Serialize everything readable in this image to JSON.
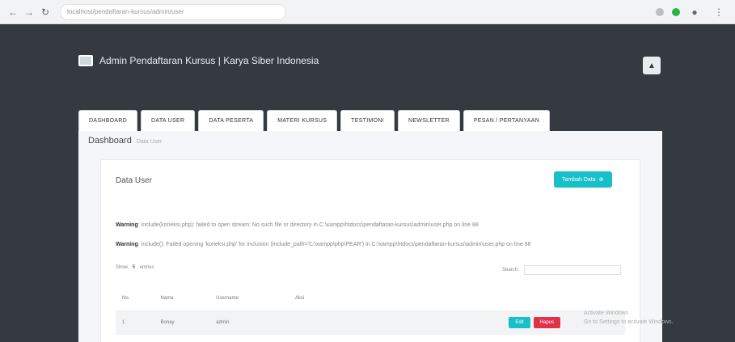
{
  "browser": {
    "url": "localhost/pendaftaran-kursus/admin/user"
  },
  "header": {
    "title": "Admin Pendaftaran Kursus | Karya Siber Indonesia"
  },
  "tabs": [
    {
      "label": "DASHBOARD"
    },
    {
      "label": "DATA USER"
    },
    {
      "label": "DATA PESERTA"
    },
    {
      "label": "MATERI KURSUS"
    },
    {
      "label": "TESTIMONI"
    },
    {
      "label": "NEWSLETTER"
    },
    {
      "label": "PESAN / PERTANYAAN"
    }
  ],
  "breadcrumb": {
    "title": "Dashboard",
    "sub": "Data User"
  },
  "card": {
    "title": "Data User",
    "add_label": "Tambah Data"
  },
  "warnings": [
    {
      "label": "Warning",
      "text": ": include(koneksi.php): failed to open stream: No such file or directory in C:\\xampp\\htdocs\\pendaftaran-kursus\\admin\\user.php on line 88"
    },
    {
      "label": "Warning",
      "text": ": include(): Failed opening 'koneksi.php' for inclusion (include_path='C:\\xampp\\php\\PEAR') in C:\\xampp\\htdocs\\pendaftaran-kursus\\admin\\user.php on line 88"
    }
  ],
  "table_controls": {
    "show_label": "Show",
    "show_value": "5",
    "entries_label": "entries",
    "search_label": "Search:"
  },
  "table": {
    "headers": [
      "No.",
      "Nama",
      "Username",
      "Aksi"
    ],
    "rows": [
      {
        "no": "1",
        "nama": "Bonay",
        "username": "admin",
        "edit": "Edit",
        "hapus": "Hapus"
      }
    ]
  },
  "watermark": {
    "line1": "Activate Windows",
    "line2": "Go to Settings to activate Windows."
  },
  "colors": {
    "accent": "#17c0c8",
    "danger": "#e0334b",
    "dark": "#343a40"
  }
}
